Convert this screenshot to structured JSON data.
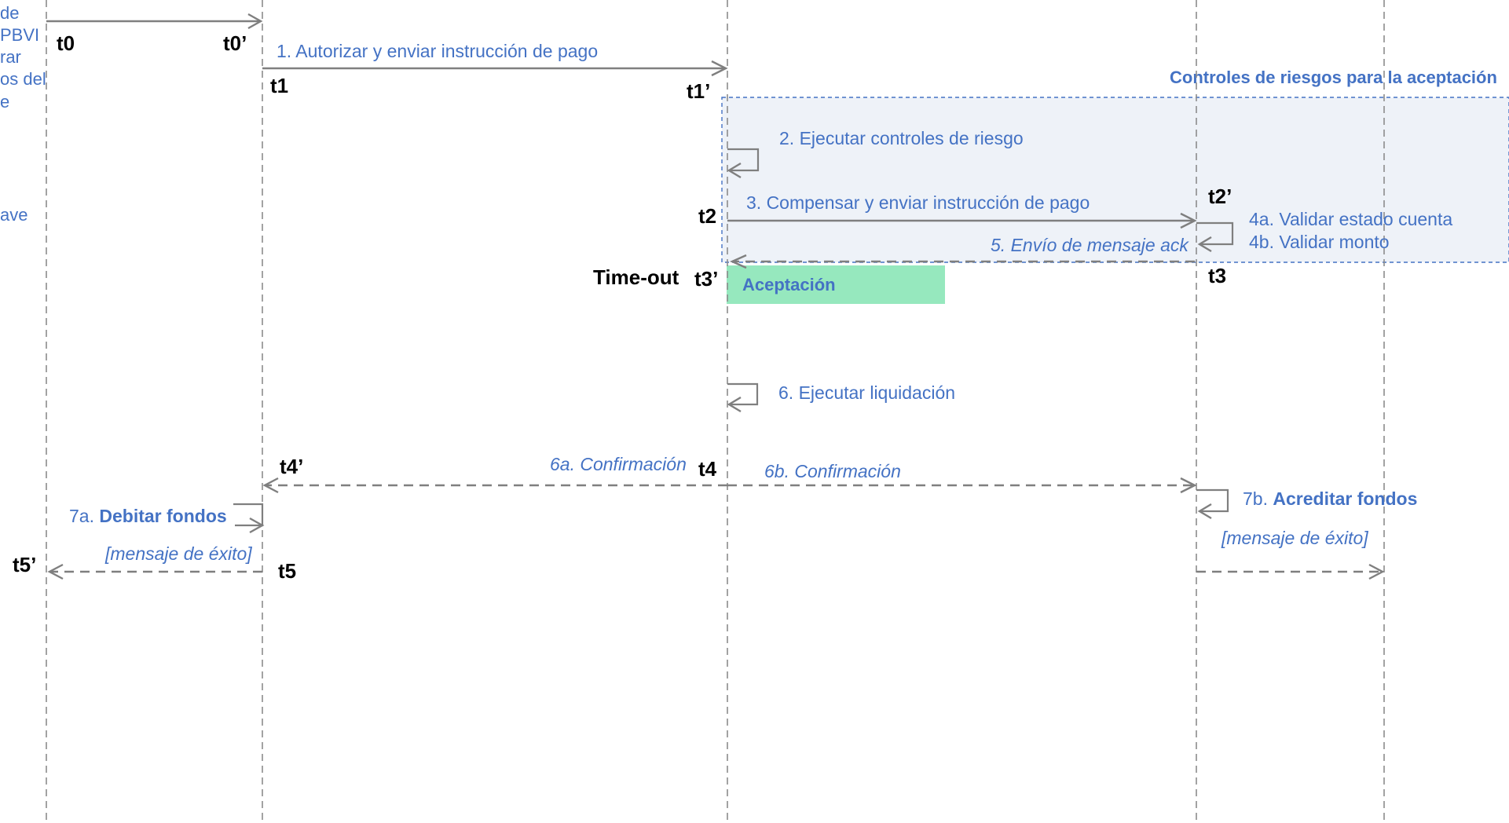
{
  "side_text": [
    "de",
    "PBVI",
    "rar",
    "os del",
    "e",
    "",
    "",
    "",
    "ave"
  ],
  "region_title": "Controles de riesgos para la aceptación",
  "acceptance_label": "Aceptación",
  "timeout_label": "Time-out",
  "time_marks": {
    "t0": "t0",
    "t0p": "t0’",
    "t1": "t1",
    "t1p": "t1’",
    "t2": "t2",
    "t2p": "t2’",
    "t3": "t3",
    "t3p": "t3’",
    "t4": "t4",
    "t4p": "t4’",
    "t5": "t5",
    "t5p": "t5’"
  },
  "steps": {
    "s1": "1. Autorizar y enviar instrucción de pago",
    "s2": "2. Ejecutar controles de riesgo",
    "s3": "3. Compensar y enviar instrucción de pago",
    "s4a": "4a. Validar estado cuenta",
    "s4b": "4b. Validar monto",
    "s5": "5. Envío de mensaje ack",
    "s6": "6. Ejecutar liquidación",
    "s6a": "6a. Confirmación",
    "s6b": "6b. Confirmación",
    "s7a_prefix": "7a. ",
    "s7a_bold": "Debitar fondos",
    "s7b_prefix": "7b. ",
    "s7b_bold": "Acreditar fondos",
    "success_left": "[mensaje de éxito]",
    "success_right": "[mensaje de éxito]"
  },
  "colors": {
    "label": "#4472C4",
    "region_fill": "#EEF2F8",
    "region_border": "#4472C4",
    "acceptance_fill": "#96E8BE",
    "arrow": "#7F7F7F",
    "lifeline": "#8C8C8C"
  }
}
